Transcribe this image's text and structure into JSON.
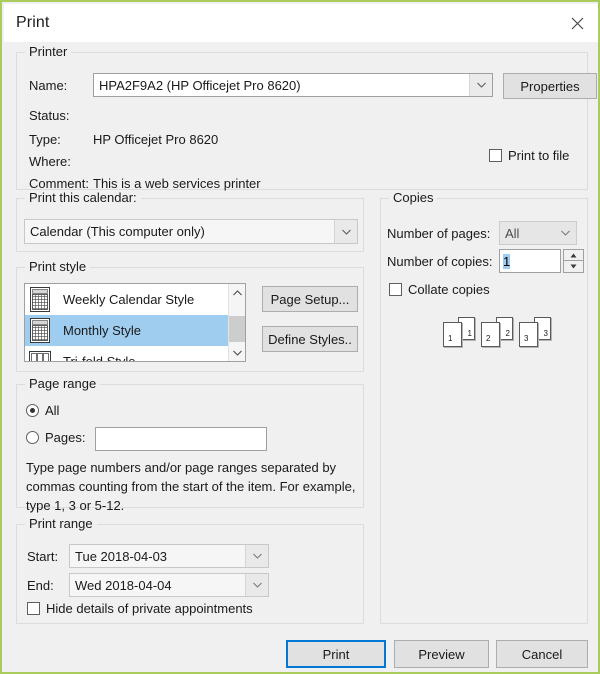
{
  "window": {
    "title": "Print",
    "close_icon": "close-icon",
    "border_color": "#a9cc5c"
  },
  "printer": {
    "legend": "Printer",
    "name_label": "Name:",
    "name_value": "HPA2F9A2 (HP Officejet Pro 8620)",
    "properties_button": "Properties",
    "status_label": "Status:",
    "status_value": "",
    "type_label": "Type:",
    "type_value": "HP Officejet Pro 8620",
    "where_label": "Where:",
    "where_value": "",
    "comment_label": "Comment:",
    "comment_value": "This is a web services printer",
    "print_to_file_label": "Print to file",
    "print_to_file_checked": false
  },
  "print_this_calendar": {
    "label": "Print this calendar:",
    "value": "Calendar (This computer only)"
  },
  "print_style": {
    "legend": "Print style",
    "items": [
      {
        "label": "Weekly Calendar Style",
        "icon": "calendar-grid-icon",
        "selected": false
      },
      {
        "label": "Monthly Style",
        "icon": "calendar-grid-icon",
        "selected": true
      },
      {
        "label": "Tri-fold Style",
        "icon": "trifold-columns-icon",
        "selected": false
      }
    ],
    "page_setup_button": "Page Setup...",
    "define_styles_button": "Define Styles.."
  },
  "copies": {
    "legend": "Copies",
    "number_of_pages_label": "Number of pages:",
    "number_of_pages_value": "All",
    "number_of_copies_label": "Number of copies:",
    "number_of_copies_value": "1",
    "collate_label": "Collate copies",
    "collate_checked": false,
    "preview_numbers": [
      "1",
      "2",
      "3"
    ]
  },
  "page_range": {
    "legend": "Page range",
    "all_label": "All",
    "all_selected": true,
    "pages_label": "Pages:",
    "pages_selected": false,
    "pages_value": "",
    "help_text": "Type page numbers and/or page ranges separated by commas counting from the start of the item.  For example, type 1, 3 or 5-12."
  },
  "print_range": {
    "legend": "Print range",
    "start_label": "Start:",
    "start_value": "Tue 2018-04-03",
    "end_label": "End:",
    "end_value": "Wed 2018-04-04",
    "hide_details_label": "Hide details of private appointments",
    "hide_details_checked": false
  },
  "footer": {
    "print_button": "Print",
    "preview_button": "Preview",
    "cancel_button": "Cancel"
  }
}
